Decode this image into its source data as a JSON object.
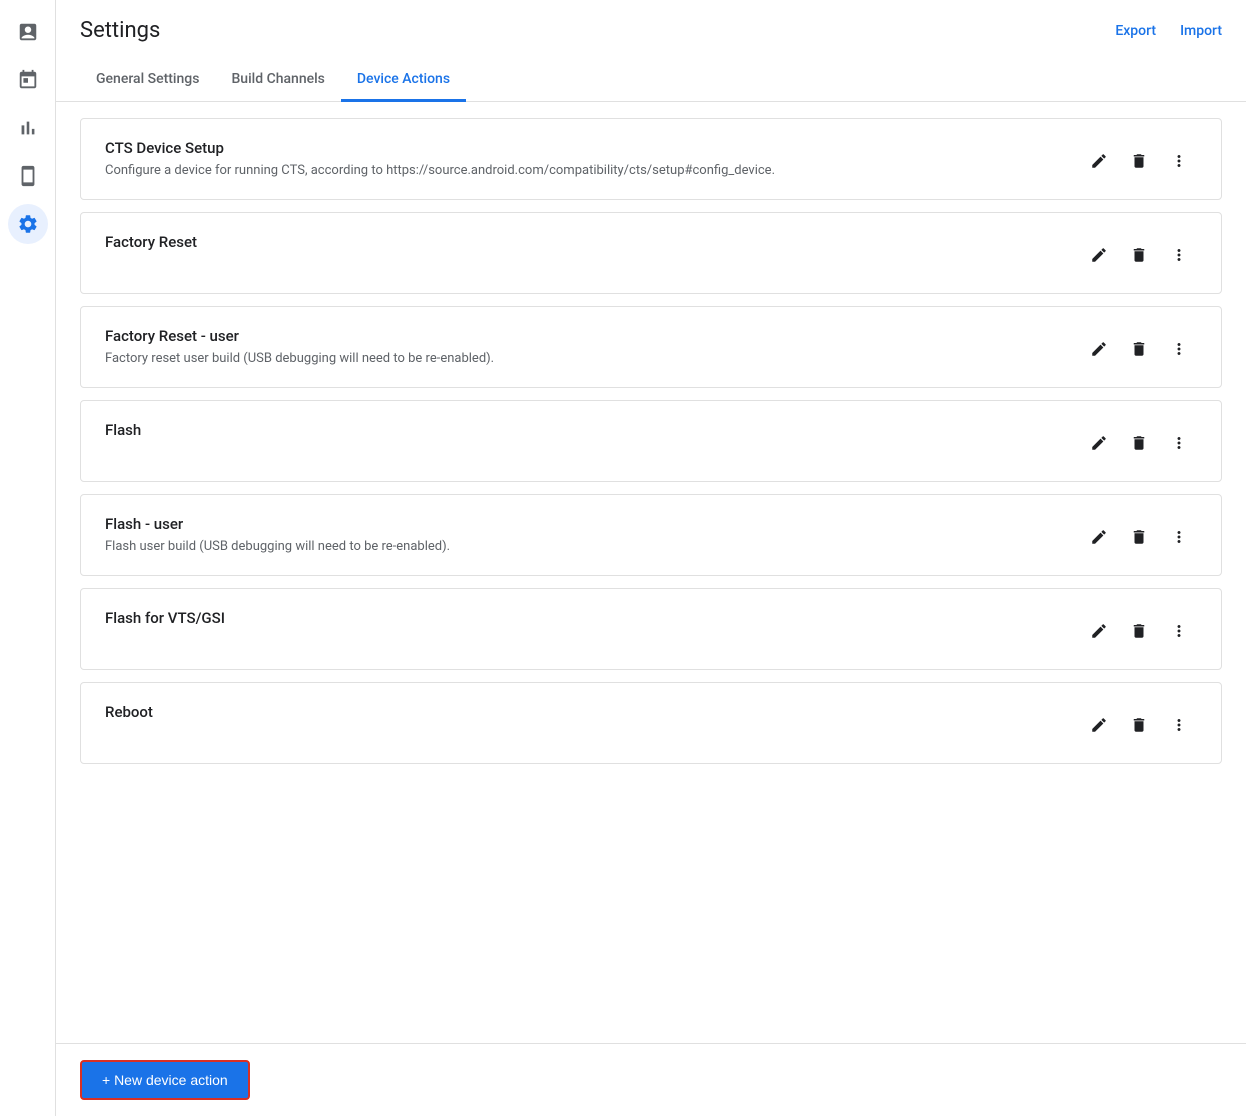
{
  "header": {
    "title": "Settings",
    "export_label": "Export",
    "import_label": "Import"
  },
  "tabs": [
    {
      "id": "general",
      "label": "General Settings",
      "active": false
    },
    {
      "id": "build-channels",
      "label": "Build Channels",
      "active": false
    },
    {
      "id": "device-actions",
      "label": "Device Actions",
      "active": true
    }
  ],
  "actions": [
    {
      "id": 1,
      "title": "CTS Device Setup",
      "description": "Configure a device for running CTS, according to https://source.android.com/compatibility/cts/setup#config_device."
    },
    {
      "id": 2,
      "title": "Factory Reset",
      "description": ""
    },
    {
      "id": 3,
      "title": "Factory Reset - user",
      "description": "Factory reset user build (USB debugging will need to be re-enabled)."
    },
    {
      "id": 4,
      "title": "Flash",
      "description": ""
    },
    {
      "id": 5,
      "title": "Flash - user",
      "description": "Flash user build (USB debugging will need to be re-enabled)."
    },
    {
      "id": 6,
      "title": "Flash for VTS/GSI",
      "description": ""
    },
    {
      "id": 7,
      "title": "Reboot",
      "description": ""
    }
  ],
  "footer": {
    "new_action_label": "+ New device action"
  },
  "sidebar": {
    "items": [
      {
        "id": "reports",
        "icon": "reports"
      },
      {
        "id": "schedule",
        "icon": "schedule"
      },
      {
        "id": "analytics",
        "icon": "analytics"
      },
      {
        "id": "device",
        "icon": "device"
      },
      {
        "id": "settings",
        "icon": "settings",
        "active": true
      }
    ]
  }
}
